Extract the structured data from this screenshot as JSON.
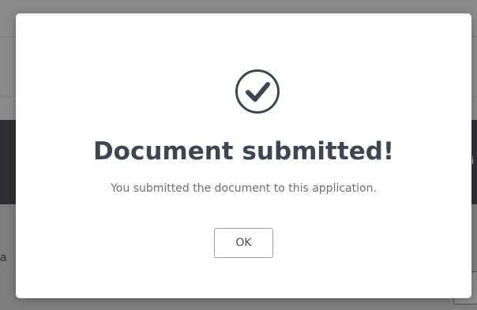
{
  "dialog": {
    "icon": "check-circle-icon",
    "title": "Document submitted!",
    "message": "You submitted the document to this application.",
    "ok_label": "OK"
  },
  "background": {
    "left_glyph": "a",
    "right_glyph": "i"
  },
  "colors": {
    "title": "#3e4651",
    "message": "#6a6f75",
    "icon": "#3e4651",
    "overlay": "#7d7d7d"
  }
}
